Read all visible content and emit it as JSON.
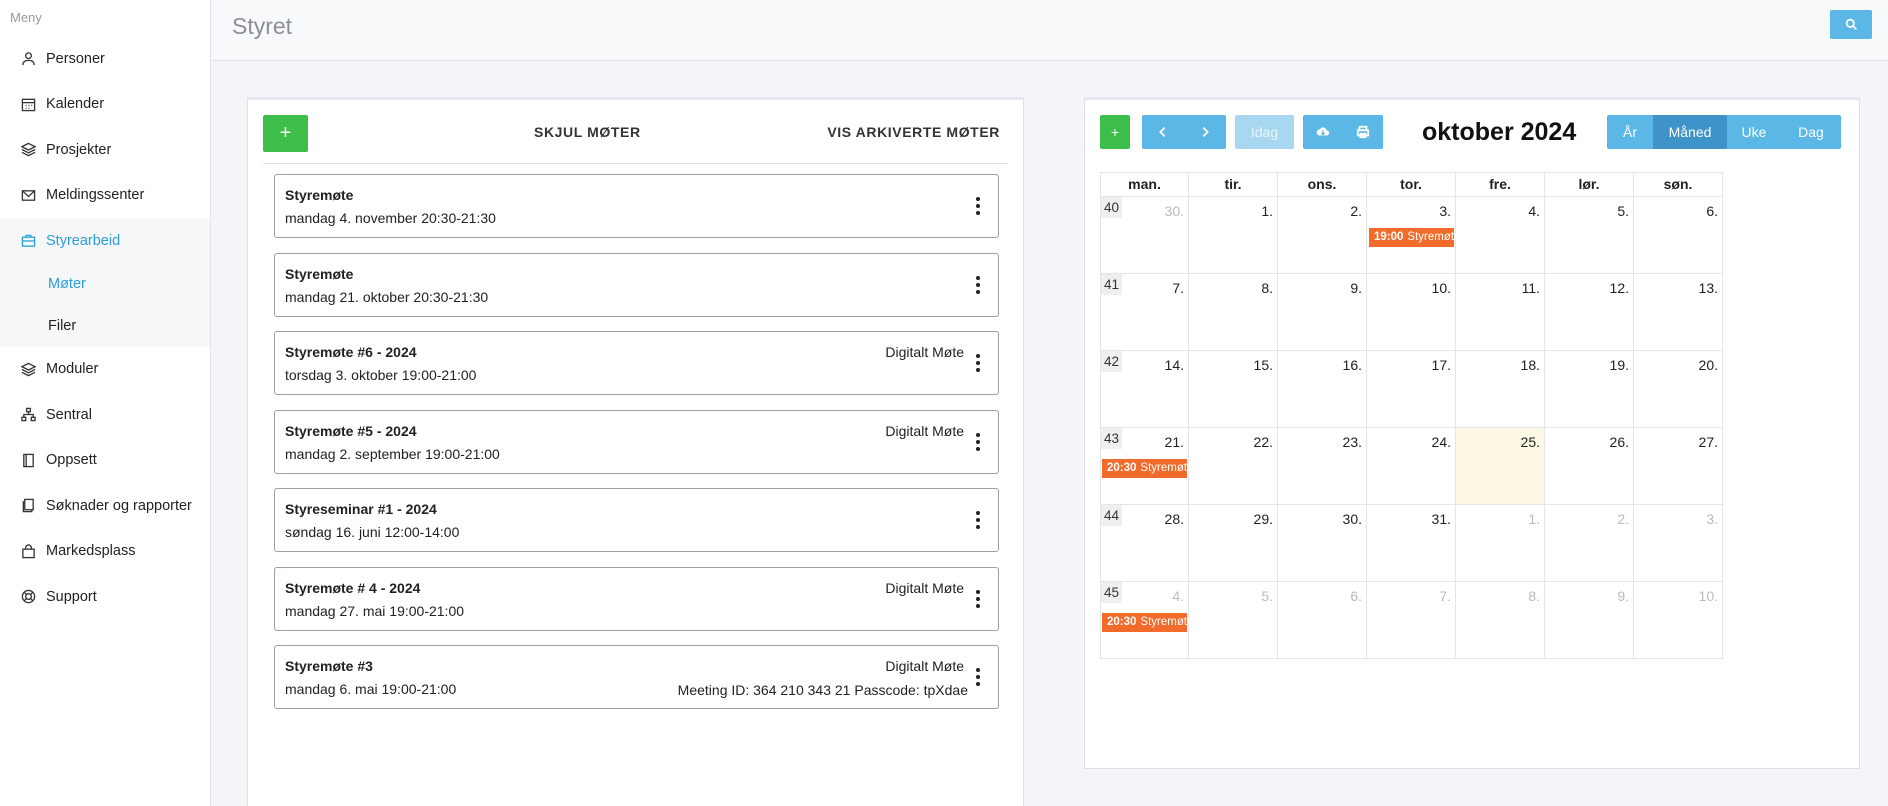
{
  "sidebar": {
    "heading": "Meny",
    "items": [
      {
        "label": "Personer",
        "icon": "person-icon"
      },
      {
        "label": "Kalender",
        "icon": "calendar-icon"
      },
      {
        "label": "Prosjekter",
        "icon": "layers-icon"
      },
      {
        "label": "Meldingssenter",
        "icon": "mail-icon"
      },
      {
        "label": "Styrearbeid",
        "icon": "briefcase-icon",
        "active": true
      },
      {
        "label": "Moduler",
        "icon": "layers-icon"
      },
      {
        "label": "Sentral",
        "icon": "sitemap-icon"
      },
      {
        "label": "Oppsett",
        "icon": "book-icon"
      },
      {
        "label": "Søknader og rapporter",
        "icon": "documents-icon"
      },
      {
        "label": "Markedsplass",
        "icon": "shopping-bag-icon"
      },
      {
        "label": "Support",
        "icon": "lifebuoy-icon"
      }
    ],
    "subitems": [
      {
        "label": "Møter",
        "active": true
      },
      {
        "label": "Filer"
      }
    ]
  },
  "header": {
    "title": "Styret"
  },
  "meetings_panel": {
    "add_label": "+",
    "hide_label": "SKJUL MØTER",
    "archived_label": "VIS ARKIVERTE MØTER",
    "meetings": [
      {
        "title": "Styremøte",
        "date": "mandag 4. november 20:30-21:30",
        "type": "",
        "extra": ""
      },
      {
        "title": "Styremøte",
        "date": "mandag 21. oktober 20:30-21:30",
        "type": "",
        "extra": ""
      },
      {
        "title": "Styremøte #6 - 2024",
        "date": "torsdag 3. oktober 19:00-21:00",
        "type": "Digitalt Møte",
        "extra": ""
      },
      {
        "title": "Styremøte #5 - 2024",
        "date": "mandag 2. september 19:00-21:00",
        "type": "Digitalt Møte",
        "extra": ""
      },
      {
        "title": "Styreseminar #1 - 2024",
        "date": "søndag 16. juni 12:00-14:00",
        "type": "",
        "extra": ""
      },
      {
        "title": "Styremøte # 4 - 2024",
        "date": "mandag 27. mai 19:00-21:00",
        "type": "Digitalt Møte",
        "extra": ""
      },
      {
        "title": "Styremøte #3",
        "date": "mandag 6. mai 19:00-21:00",
        "type": "Digitalt Møte",
        "extra": "Meeting ID: 364 210 343 21 Passcode: tpXdae"
      }
    ]
  },
  "calendar": {
    "add_label": "+",
    "today_label": "Idag",
    "title": "oktober 2024",
    "views": [
      "År",
      "Måned",
      "Uke",
      "Dag"
    ],
    "active_view": "Måned",
    "weekdays": [
      "man.",
      "tir.",
      "ons.",
      "tor.",
      "fre.",
      "lør.",
      "søn."
    ],
    "weeks": [
      {
        "num": "40",
        "days": [
          "30.",
          "1.",
          "2.",
          "3.",
          "4.",
          "5.",
          "6."
        ]
      },
      {
        "num": "41",
        "days": [
          "7.",
          "8.",
          "9.",
          "10.",
          "11.",
          "12.",
          "13."
        ]
      },
      {
        "num": "42",
        "days": [
          "14.",
          "15.",
          "16.",
          "17.",
          "18.",
          "19.",
          "20."
        ]
      },
      {
        "num": "43",
        "days": [
          "21.",
          "22.",
          "23.",
          "24.",
          "25.",
          "26.",
          "27."
        ]
      },
      {
        "num": "44",
        "days": [
          "28.",
          "29.",
          "30.",
          "31.",
          "1.",
          "2.",
          "3."
        ]
      },
      {
        "num": "45",
        "days": [
          "4.",
          "5.",
          "6.",
          "7.",
          "8.",
          "9.",
          "10."
        ]
      }
    ],
    "other_month": [
      [
        0,
        0
      ],
      [
        4,
        4
      ],
      [
        4,
        5
      ],
      [
        4,
        6
      ],
      [
        5,
        0
      ],
      [
        5,
        1
      ],
      [
        5,
        2
      ],
      [
        5,
        3
      ],
      [
        5,
        4
      ],
      [
        5,
        5
      ],
      [
        5,
        6
      ]
    ],
    "today": [
      3,
      4
    ],
    "events": [
      {
        "week": 0,
        "day": 3,
        "time": "19:00",
        "title": "Styremøte"
      },
      {
        "week": 3,
        "day": 0,
        "time": "20:30",
        "title": "Styremøte"
      },
      {
        "week": 5,
        "day": 0,
        "time": "20:30",
        "title": "Styremøte"
      }
    ],
    "colors": {
      "event": "#f26b2a",
      "today": "#fcf8e3",
      "accent": "#5bb7e5"
    }
  }
}
